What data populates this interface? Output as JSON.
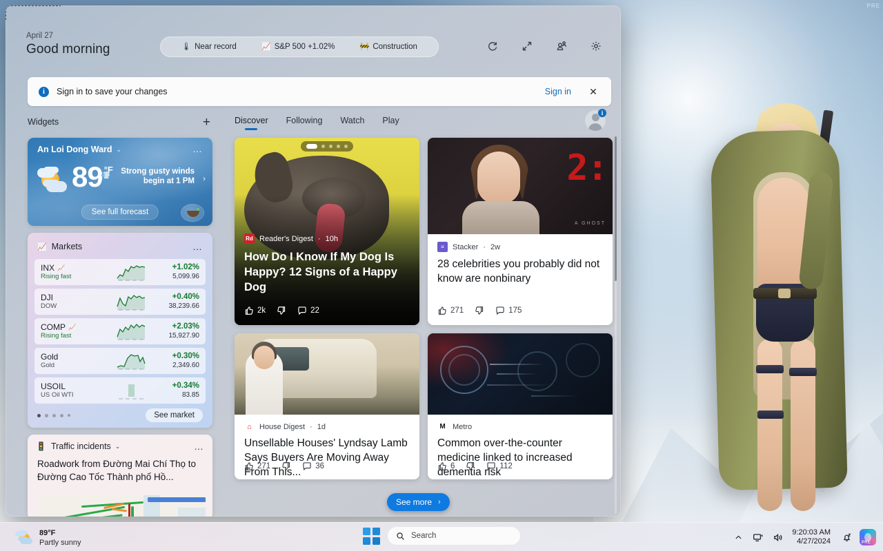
{
  "desktop": {
    "wallpaper_watermark": "PRE"
  },
  "widgets_panel": {
    "header": {
      "date": "April 27",
      "greeting": "Good morning",
      "pill_items": [
        {
          "icon": "thermometer-icon",
          "glyph": "🌡",
          "label": "Near record"
        },
        {
          "icon": "stock-chart-icon",
          "glyph": "📈",
          "label": "S&P 500 +1.02%"
        },
        {
          "icon": "construction-icon",
          "glyph": "🚧",
          "label": "Construction"
        }
      ],
      "actions": [
        {
          "name": "refresh-button",
          "label": "Refresh"
        },
        {
          "name": "expand-button",
          "label": "Expand"
        },
        {
          "name": "personalize-button",
          "label": "Personalize"
        },
        {
          "name": "settings-button",
          "label": "Settings"
        }
      ]
    },
    "signin_banner": {
      "info_glyph": "i",
      "message": "Sign in to save your changes",
      "link_label": "Sign in",
      "close_glyph": "✕"
    },
    "widgets_column": {
      "title": "Widgets",
      "add_glyph": "+",
      "weather": {
        "location": "An Loi Dong Ward",
        "chevron": "⌄",
        "more_glyph": "…",
        "temperature": "89",
        "unit": "°F",
        "alert_icon_glyph": "💨",
        "alert_line1": "Strong gusty winds",
        "alert_line2": "begin at 1 PM",
        "alert_chevron": "›",
        "forecast_label": "See full forecast"
      },
      "markets": {
        "icon_glyph": "📈",
        "title": "Markets",
        "more_glyph": "…",
        "rows": [
          {
            "symbol": "INX",
            "has_up_icon": true,
            "subtitle": "Rising fast",
            "rising": true,
            "percent": "+1.02%",
            "value": "5,099.96"
          },
          {
            "symbol": "DJI",
            "has_up_icon": false,
            "subtitle": "DOW",
            "rising": false,
            "percent": "+0.40%",
            "value": "38,239.66"
          },
          {
            "symbol": "COMP",
            "has_up_icon": true,
            "subtitle": "Rising fast",
            "rising": true,
            "percent": "+2.03%",
            "value": "15,927.90"
          },
          {
            "symbol": "Gold",
            "has_up_icon": false,
            "subtitle": "Gold",
            "rising": false,
            "percent": "+0.30%",
            "value": "2,349.60"
          },
          {
            "symbol": "USOIL",
            "has_up_icon": false,
            "subtitle": "US Oil WTI",
            "rising": false,
            "percent": "+0.34%",
            "value": "83.85"
          }
        ],
        "see_market_label": "See market",
        "page_dots": 5,
        "active_dot": 0
      },
      "traffic": {
        "icon_glyph": "🚦",
        "title": "Traffic incidents",
        "chevron": "⌄",
        "more_glyph": "…",
        "headline": "Roadwork from Đường Mai Chí Thọ to Đường Cao Tốc Thành phố Hồ..."
      }
    },
    "news": {
      "tabs": [
        {
          "label": "Discover",
          "active": true
        },
        {
          "label": "Following",
          "active": false
        },
        {
          "label": "Watch",
          "active": false
        },
        {
          "label": "Play",
          "active": false
        }
      ],
      "avatar_badge": "i",
      "see_more_label": "See more",
      "see_more_chevron": "›",
      "cards": [
        {
          "id": "dog",
          "source": "Reader's Digest",
          "source_initials": "Rd",
          "source_color": "#d4202a",
          "time": "10h",
          "title": "How Do I Know If My Dog Is Happy? 12 Signs of a Happy Dog",
          "likes": "2k",
          "comments": "22",
          "carousel_dots": 4
        },
        {
          "id": "celeb",
          "source": "Stacker",
          "source_initials": "≡",
          "source_color": "#6a5acd",
          "time": "2w",
          "title": "28 celebrities you probably did not know are nonbinary",
          "likes": "271",
          "comments": "175",
          "image_digits": "2:"
        },
        {
          "id": "house",
          "source": "House Digest",
          "source_initials": "⌂",
          "source_color": "#ffffff",
          "time": "1d",
          "title": "Unsellable Houses' Lyndsay Lamb Says Buyers Are Moving Away From This...",
          "likes": "271",
          "comments": "36"
        },
        {
          "id": "brain",
          "source": "Metro",
          "source_initials": "M",
          "source_color": "#ffffff",
          "time": "",
          "title": "Common over-the-counter medicine linked to increased dementia risk",
          "likes": "6",
          "comments": "112"
        }
      ]
    }
  },
  "taskbar": {
    "weather": {
      "temperature": "89°F",
      "condition": "Partly sunny"
    },
    "search": {
      "placeholder": "Search"
    },
    "tray": {
      "time": "9:20:03 AM",
      "date": "4/27/2024",
      "copilot_label": "PRE"
    }
  },
  "colors": {
    "accent_blue": "#0f6cbd",
    "see_more_blue": "#0f7ae0",
    "market_green": "#157a2e",
    "weather_blue": "#3b82bd"
  }
}
